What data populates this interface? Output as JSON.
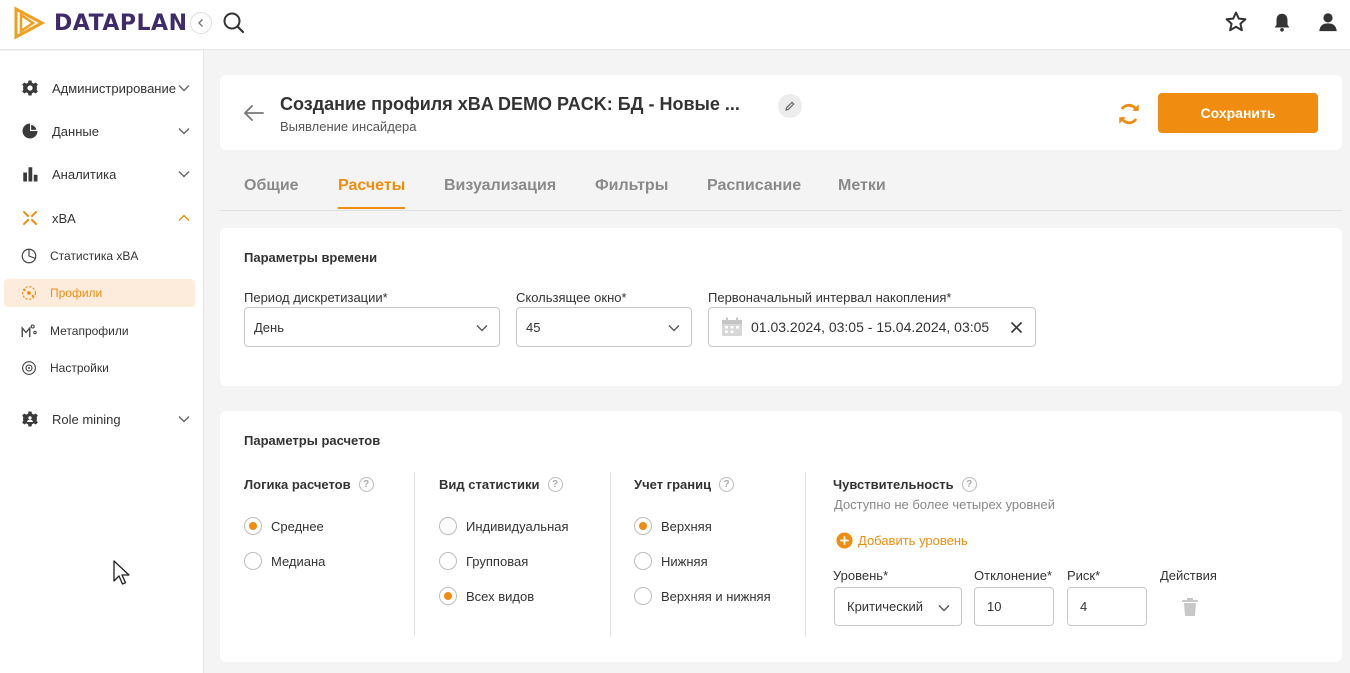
{
  "app": {
    "logo_text": "DATAPLAN"
  },
  "sidebar": {
    "items": [
      {
        "label": "Администрирование",
        "icon": "gear-icon"
      },
      {
        "label": "Данные",
        "icon": "pie-chart-icon"
      },
      {
        "label": "Аналитика",
        "icon": "bar-chart-icon"
      },
      {
        "label": "xBA",
        "icon": "xba-icon"
      },
      {
        "label": "Role mining",
        "icon": "cog-people-icon"
      }
    ],
    "xba_sub": [
      {
        "label": "Статистика xBA",
        "icon": "stats-pie-icon"
      },
      {
        "label": "Профили",
        "icon": "profiles-icon"
      },
      {
        "label": "Метапрофили",
        "icon": "metaprofiles-icon"
      },
      {
        "label": "Настройки",
        "icon": "settings-icon"
      }
    ]
  },
  "header": {
    "title": "Создание профиля xBA DEMO PACK: БД - Новые ...",
    "subtitle": "Выявление инсайдера",
    "save_label": "Сохранить"
  },
  "tabs": [
    {
      "label": "Общие"
    },
    {
      "label": "Расчеты",
      "active": true
    },
    {
      "label": "Визуализация"
    },
    {
      "label": "Фильтры"
    },
    {
      "label": "Расписание"
    },
    {
      "label": "Метки"
    }
  ],
  "time_params": {
    "title": "Параметры времени",
    "period_label": "Период дискретизации*",
    "period_value": "День",
    "window_label": "Скользящее окно*",
    "window_value": "45",
    "interval_label": "Первоначальный интервал накопления*",
    "interval_value": "01.03.2024, 03:05 - 15.04.2024, 03:05"
  },
  "calc_params": {
    "title": "Параметры расчетов",
    "logic": {
      "title": "Логика расчетов",
      "options": [
        "Среднее",
        "Медиана"
      ],
      "selected": 0
    },
    "stat_type": {
      "title": "Вид статистики",
      "options": [
        "Индивидуальная",
        "Групповая",
        "Всех видов"
      ],
      "selected": 2
    },
    "bounds": {
      "title": "Учет границ",
      "options": [
        "Верхняя",
        "Нижняя",
        "Верхняя и нижняя"
      ],
      "selected": 0
    },
    "sensitivity": {
      "title": "Чувствительность",
      "hint": "Доступно не более четырех уровней",
      "add_label": "Добавить уровень",
      "level_label": "Уровень*",
      "deviation_label": "Отклонение*",
      "risk_label": "Риск*",
      "actions_label": "Действия",
      "level_value": "Критический",
      "deviation_value": "10",
      "risk_value": "4"
    }
  },
  "colors": {
    "accent": "#f08c0f",
    "brand": "#3f2b69"
  }
}
